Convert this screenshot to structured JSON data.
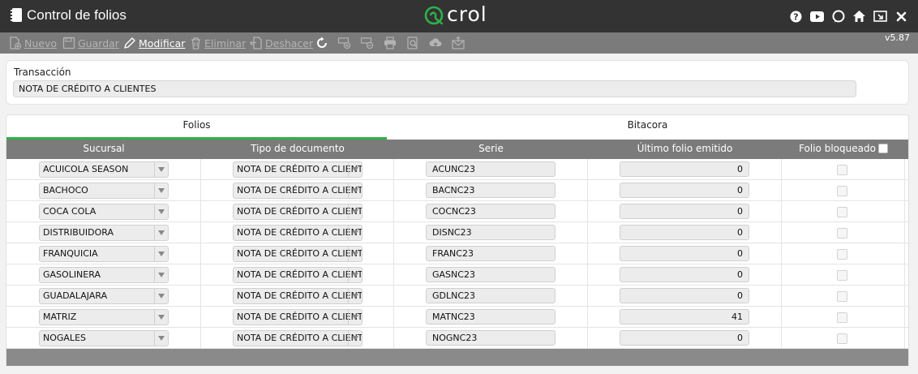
{
  "window": {
    "title": "Control de folios",
    "logo_text": "crol",
    "version": "v5.87",
    "title_icons": [
      "help-icon",
      "youtube-icon",
      "chat-icon",
      "home-icon",
      "popout-icon",
      "close-icon"
    ]
  },
  "toolbar": {
    "nuevo": "Nuevo",
    "guardar": "Guardar",
    "modificar": "Modificar",
    "eliminar": "Eliminar",
    "deshacer": "Deshacer",
    "icons": [
      "refresh-icon",
      "add-row-icon",
      "remove-row-icon",
      "print-icon",
      "print-preview-icon",
      "cloud-upload-icon",
      "email-icon"
    ]
  },
  "transaction": {
    "label": "Transacción",
    "value": "NOTA DE CRÉDITO A CLIENTES"
  },
  "tabs": [
    {
      "label": "Folios"
    },
    {
      "label": "Bitacora"
    }
  ],
  "grid": {
    "columns": [
      "Sucursal",
      "Tipo de documento",
      "Serie",
      "Último folio emitido",
      "Folio bloqueado"
    ],
    "rows": [
      {
        "sucursal": "ACUICOLA SEASON",
        "tipo": "NOTA DE CRÉDITO A CLIENTES",
        "serie": "ACUNC23",
        "folio": "0"
      },
      {
        "sucursal": "BACHOCO",
        "tipo": "NOTA DE CRÉDITO A CLIENTES",
        "serie": "BACNC23",
        "folio": "0"
      },
      {
        "sucursal": "COCA COLA",
        "tipo": "NOTA DE CRÉDITO A CLIENTES",
        "serie": "COCNC23",
        "folio": "0"
      },
      {
        "sucursal": "DISTRIBUIDORA",
        "tipo": "NOTA DE CRÉDITO A CLIENTES",
        "serie": "DISNC23",
        "folio": "0"
      },
      {
        "sucursal": "FRANQUICIA",
        "tipo": "NOTA DE CRÉDITO A CLIENTES",
        "serie": "FRANC23",
        "folio": "0"
      },
      {
        "sucursal": "GASOLINERA",
        "tipo": "NOTA DE CRÉDITO A CLIENTES",
        "serie": "GASNC23",
        "folio": "0"
      },
      {
        "sucursal": "GUADALAJARA",
        "tipo": "NOTA DE CRÉDITO A CLIENTES",
        "serie": "GDLNC23",
        "folio": "0"
      },
      {
        "sucursal": "MATRIZ",
        "tipo": "NOTA DE CRÉDITO A CLIENTES",
        "serie": "MATNC23",
        "folio": "41"
      },
      {
        "sucursal": "NOGALES",
        "tipo": "NOTA DE CRÉDITO A CLIENTES",
        "serie": "NOGNC23",
        "folio": "0"
      }
    ]
  },
  "colors": {
    "titlebar": "#333333",
    "toolbar": "#7b7b7b",
    "accent": "#2fb24a",
    "grid_header": "#7b7b7b"
  }
}
